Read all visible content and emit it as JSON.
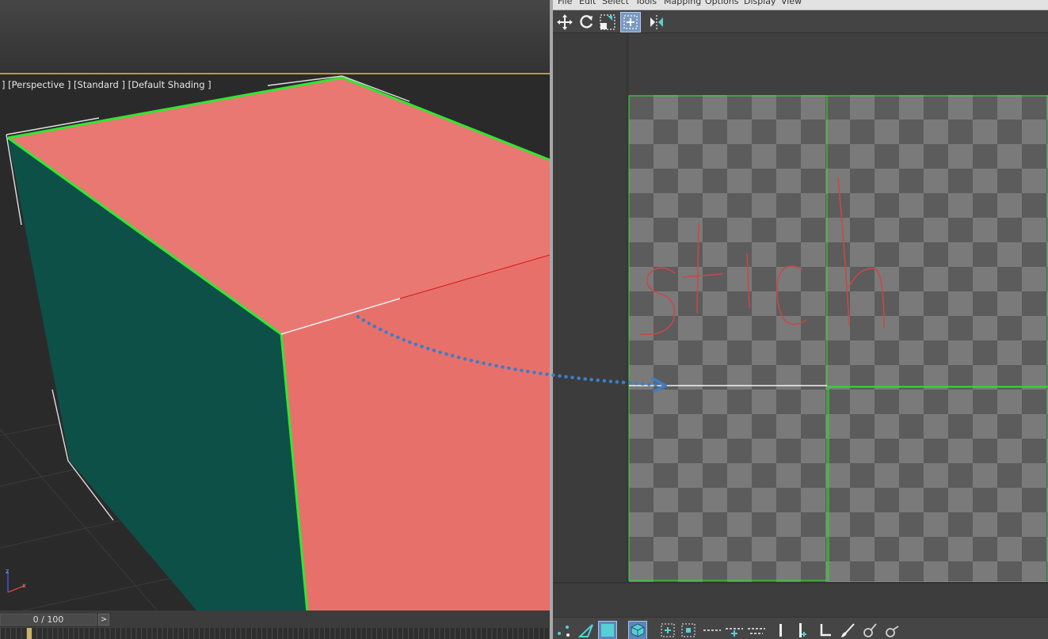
{
  "viewport": {
    "label": "] [Perspective ] [Standard ] [Default Shading ]",
    "colors": {
      "top_face": "#e97872",
      "front_face": "#e8706b",
      "side_face": "#0d5048",
      "selected_edge": "#32e632"
    },
    "time_slider": "0 / 100",
    "next_frame": ">"
  },
  "uv_editor": {
    "menu": [
      "File",
      "Edit",
      "Select",
      "Tools",
      "Mapping",
      "Options",
      "Display",
      "View"
    ],
    "top_tools": [
      "move-icon",
      "rotate-icon",
      "scale-icon",
      "freeform-icon",
      "mirror-icon"
    ],
    "bottom_tools": [
      "vertex-icon",
      "edge-icon",
      "polygon-icon",
      "element-icon",
      "grow-icon",
      "shrink-icon",
      "ring-icon",
      "loop-icon",
      "align-icon",
      "space-icon",
      "paint-icon",
      "settings-icon"
    ],
    "handwritten_note": "stich",
    "colors": {
      "checker_light": "#7a7a7a",
      "checker_dark": "#5c5c5c",
      "uv_border": "#2ee02e",
      "arrow": "#3f7dc4"
    }
  }
}
